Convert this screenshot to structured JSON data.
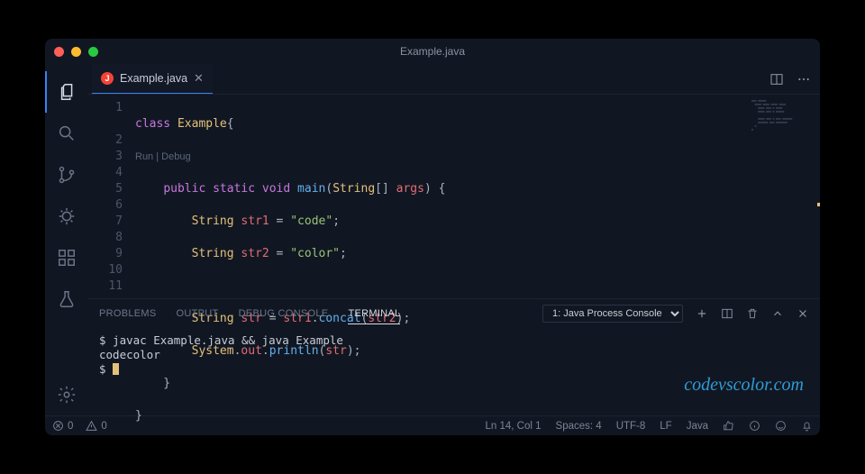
{
  "titlebar": {
    "title": "Example.java"
  },
  "tab": {
    "icon_letter": "J",
    "label": "Example.java"
  },
  "codeLens": {
    "run": "Run",
    "debug": "Debug"
  },
  "gutter": [
    "1",
    "2",
    "3",
    "4",
    "5",
    "6",
    "7",
    "8",
    "9",
    "10",
    "11"
  ],
  "code": {
    "l1": {
      "kw_class": "class",
      "name": "Example",
      "brace": "{"
    },
    "l2": {
      "kw_public": "public",
      "kw_static": "static",
      "kw_void": "void",
      "fn": "main",
      "sig1": "(",
      "typ": "String",
      "sig2": "[] ",
      "arg": "args",
      "sig3": ") {"
    },
    "l3": {
      "typ": "String",
      "var": "str1",
      "eq": " = ",
      "str": "\"code\"",
      "semi": ";"
    },
    "l4": {
      "typ": "String",
      "var": "str2",
      "eq": " = ",
      "str": "\"color\"",
      "semi": ";"
    },
    "l6": {
      "typ": "String",
      "var": "str",
      "eq": " = ",
      "v1": "str1",
      "dot": ".",
      "fn": "concat",
      "p1": "(",
      "v2": "str2",
      "p2": ");"
    },
    "l7": {
      "obj": "System",
      "d1": ".",
      "f1": "out",
      "d2": ".",
      "fn": "println",
      "p1": "(",
      "v": "str",
      "p2": ");"
    },
    "l8": "    }",
    "l9": "}"
  },
  "panel": {
    "tabs": {
      "problems": "PROBLEMS",
      "output": "OUTPUT",
      "debug": "DEBUG CONSOLE",
      "terminal": "TERMINAL"
    },
    "selector": "1: Java Process Console"
  },
  "terminal": {
    "line1": "$ javac Example.java && java Example",
    "line2": "codecolor",
    "prompt": "$ "
  },
  "watermark": "codevscolor.com",
  "status": {
    "errors": "0",
    "warnings": "0",
    "cursor": "Ln 14, Col 1",
    "spaces": "Spaces: 4",
    "encoding": "UTF-8",
    "eol": "LF",
    "lang": "Java"
  }
}
